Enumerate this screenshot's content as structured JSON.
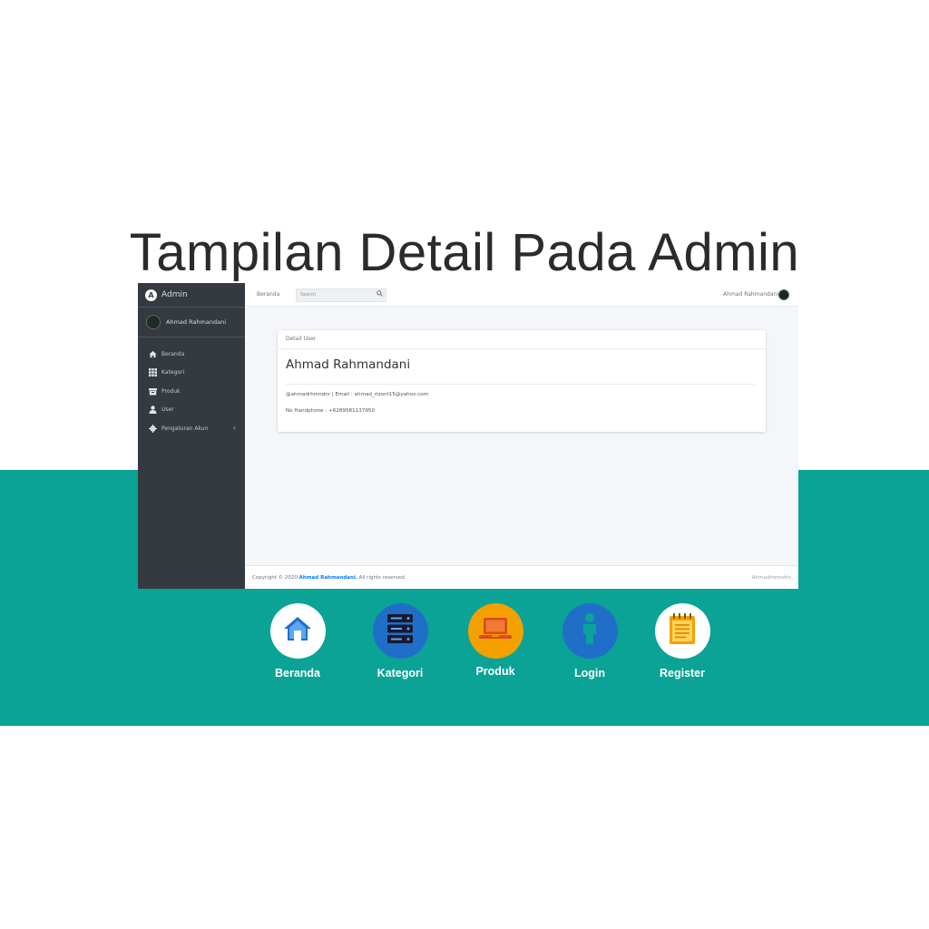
{
  "slide": {
    "title": "Tampilan Detail Pada Admin"
  },
  "admin": {
    "brand": "Admin",
    "brand_logo_letter": "A",
    "user_name": "Ahmad Rahmandani",
    "nav": [
      {
        "label": "Beranda",
        "icon": "home-icon"
      },
      {
        "label": "Kategori",
        "icon": "grid-icon"
      },
      {
        "label": "Produk",
        "icon": "box-icon"
      },
      {
        "label": "User",
        "icon": "user-icon"
      },
      {
        "label": "Pengaturan Akun",
        "icon": "settings-icon"
      }
    ],
    "topbar": {
      "home_link": "Beranda",
      "search_placeholder": "Search",
      "user_name": "Ahmad Rahmandani"
    },
    "card": {
      "header": "Detail User",
      "name": "Ahmad Rahmandani",
      "info_line": "@ahmadrhmndnr | Email : ahmad_rizont15@yahoo.com",
      "phone_line": "No Handphone : +6289581137950"
    },
    "footer": {
      "copyright_prefix": "Copyright © 2020",
      "copyright_name": "Ahmad Rahmandani.",
      "copyright_suffix": "All rights reserved.",
      "right_text": "Ahmadrhmndnr"
    }
  },
  "bottom_icons": [
    {
      "label": "Beranda",
      "icon": "home-icon",
      "circle_color": "#ffffff"
    },
    {
      "label": "Kategori",
      "icon": "server-icon",
      "circle_color": "#1f6fc9"
    },
    {
      "label": "Produk",
      "icon": "laptop-icon",
      "circle_color": "#f4a100"
    },
    {
      "label": "Login",
      "icon": "person-icon",
      "circle_color": "#1f6fc9"
    },
    {
      "label": "Register",
      "icon": "notepad-icon",
      "circle_color": "#ffffff"
    }
  ],
  "colors": {
    "teal_band": "#0aa395",
    "sidebar": "#343a40",
    "link_accent": "#007bff"
  }
}
